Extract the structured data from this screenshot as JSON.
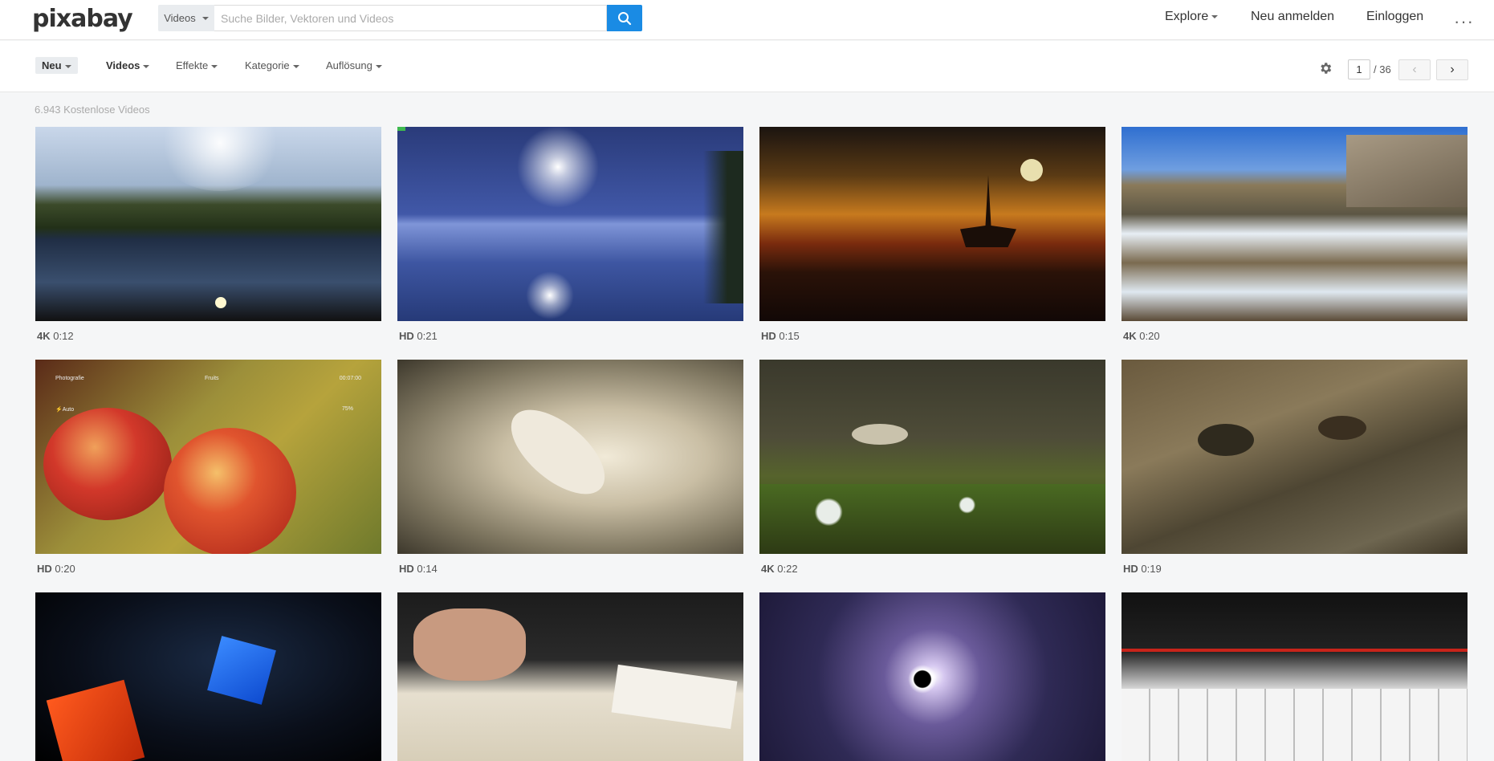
{
  "header": {
    "logo": "pixabay",
    "search_type": "Videos",
    "search_placeholder": "Suche Bilder, Vektoren und Videos",
    "nav": {
      "explore": "Explore",
      "register": "Neu anmelden",
      "login": "Einloggen",
      "more": "···"
    }
  },
  "filters": {
    "sort": "Neu",
    "type": "Videos",
    "effects": "Effekte",
    "category": "Kategorie",
    "resolution": "Auflösung"
  },
  "pager": {
    "current": "1",
    "total": "/ 36",
    "prev": "‹",
    "next": "›"
  },
  "result_count": "6.943 Kostenlose Videos",
  "videos": [
    {
      "quality": "4K",
      "duration": "0:12"
    },
    {
      "quality": "HD",
      "duration": "0:21"
    },
    {
      "quality": "HD",
      "duration": "0:15"
    },
    {
      "quality": "4K",
      "duration": "0:20"
    },
    {
      "quality": "HD",
      "duration": "0:20"
    },
    {
      "quality": "HD",
      "duration": "0:14"
    },
    {
      "quality": "4K",
      "duration": "0:22"
    },
    {
      "quality": "HD",
      "duration": "0:19"
    },
    {
      "quality": "",
      "duration": ""
    },
    {
      "quality": "",
      "duration": ""
    },
    {
      "quality": "",
      "duration": ""
    },
    {
      "quality": "",
      "duration": ""
    }
  ],
  "thumb_overlay_text": {
    "apple_top_left": "Photografie",
    "apple_top_mid": "Fruits",
    "apple_top_right": "00:07:00",
    "apple_auto": "⚡Auto",
    "apple_battery": "75%"
  },
  "colors": {
    "accent": "#1a8be4",
    "background": "#f5f6f7",
    "header_bg": "#ffffff"
  }
}
